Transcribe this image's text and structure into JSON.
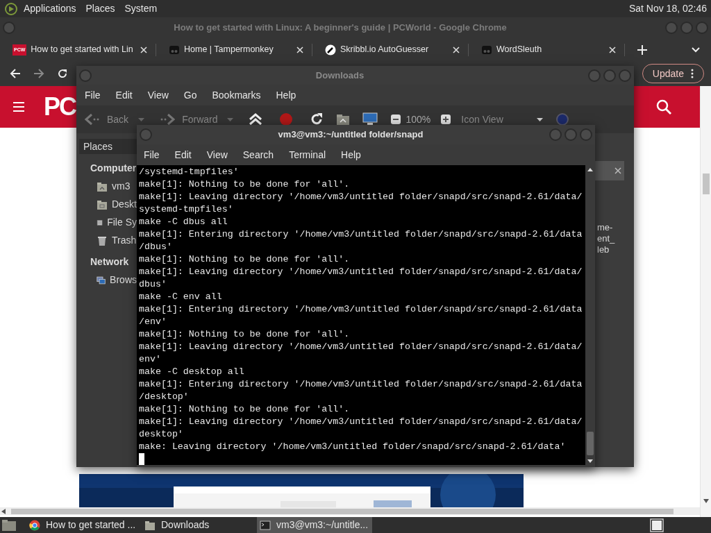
{
  "top_panel": {
    "menus": [
      "Applications",
      "Places",
      "System"
    ],
    "clock": "Sat Nov 18, 02:46"
  },
  "chrome": {
    "title": "How to get started with Linux: A beginner's guide | PCWorld - Google Chrome",
    "tabs": [
      {
        "title": "How to get started with Lin",
        "kind": "text",
        "favicon_text": "PCW"
      },
      {
        "title": "Home | Tampermonkey",
        "kind": "square"
      },
      {
        "title": "Skribbl.io AutoGuesser",
        "kind": "circle"
      },
      {
        "title": "WordSleuth",
        "kind": "square"
      }
    ],
    "update_button": "Update",
    "site_logo": "PC"
  },
  "downloads": {
    "title": "Downloads",
    "menus": [
      "File",
      "Edit",
      "View",
      "Go",
      "Bookmarks",
      "Help"
    ],
    "toolbar": {
      "back": "Back",
      "forward": "Forward",
      "zoom": "100%",
      "view": "Icon View"
    },
    "sidebar": {
      "header": "Places",
      "sections": [
        {
          "title": "Computer",
          "items": [
            {
              "label": "vm3",
              "kind": "home"
            },
            {
              "label": "Deskt",
              "kind": "folder"
            },
            {
              "label": "File Sy",
              "kind": "drive"
            },
            {
              "label": "Trash",
              "kind": "trash"
            }
          ]
        },
        {
          "title": "Network",
          "items": [
            {
              "label": "Brows",
              "kind": "network"
            }
          ]
        }
      ]
    },
    "pane_text": [
      "me-",
      "ent_",
      "leb"
    ]
  },
  "terminal": {
    "title": "vm3@vm3:~/untitled folder/snapd",
    "menus": [
      "File",
      "Edit",
      "View",
      "Search",
      "Terminal",
      "Help"
    ],
    "lines": [
      "/systemd-tmpfiles'",
      "make[1]: Nothing to be done for 'all'.",
      "make[1]: Leaving directory '/home/vm3/untitled folder/snapd/src/snapd-2.61/data/",
      "systemd-tmpfiles'",
      "make -C dbus all",
      "make[1]: Entering directory '/home/vm3/untitled folder/snapd/src/snapd-2.61/data",
      "/dbus'",
      "make[1]: Nothing to be done for 'all'.",
      "make[1]: Leaving directory '/home/vm3/untitled folder/snapd/src/snapd-2.61/data/",
      "dbus'",
      "make -C env all",
      "make[1]: Entering directory '/home/vm3/untitled folder/snapd/src/snapd-2.61/data",
      "/env'",
      "make[1]: Nothing to be done for 'all'.",
      "make[1]: Leaving directory '/home/vm3/untitled folder/snapd/src/snapd-2.61/data/",
      "env'",
      "make -C desktop all",
      "make[1]: Entering directory '/home/vm3/untitled folder/snapd/src/snapd-2.61/data",
      "/desktop'",
      "make[1]: Nothing to be done for 'all'.",
      "make[1]: Leaving directory '/home/vm3/untitled folder/snapd/src/snapd-2.61/data/",
      "desktop'",
      "make: Leaving directory '/home/vm3/untitled folder/snapd/src/snapd-2.61/data'"
    ]
  },
  "taskbar": {
    "items": [
      {
        "label": "How to get started ...",
        "kind": "browser",
        "selected": false
      },
      {
        "label": "Downloads",
        "kind": "folder",
        "selected": false
      },
      {
        "label": "vm3@vm3:~/untitle...",
        "kind": "terminal",
        "selected": true
      }
    ]
  }
}
